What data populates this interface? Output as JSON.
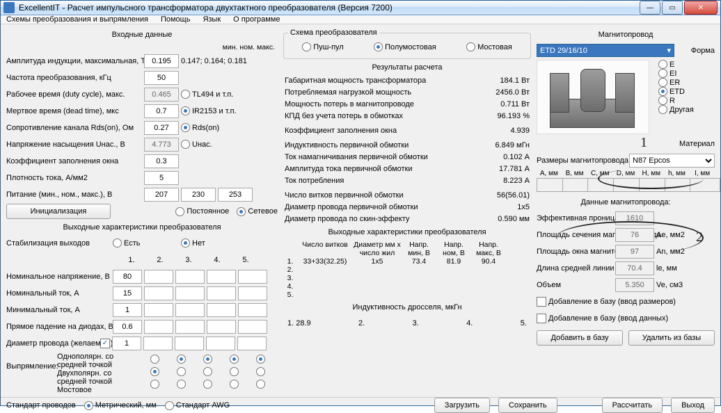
{
  "window_title": "ExcellentIT - Расчет импульсного трансформатора двухтактного преобразователя (Версия 7200)",
  "menu": {
    "m1": "Схемы преобразования и выпрямления",
    "m2": "Помощь",
    "m3": "Язык",
    "m4": "О программе"
  },
  "input": {
    "title": "Входные данные",
    "cols": "мин.  ном.  макс.",
    "r1": {
      "lbl": "Амплитуда индукции, максимальная, Т",
      "v": "0.195",
      "note": "0.147; 0.164; 0.181"
    },
    "r2": {
      "lbl": "Частота преобразования, кГц",
      "v": "50"
    },
    "r3": {
      "lbl": "Рабочее время (duty cycle), макс.",
      "v": "0.465",
      "opt": "TL494 и т.п."
    },
    "r4": {
      "lbl": "Мертвое время (dead time), мкс",
      "v": "0.7",
      "opt": "IR2153 и т.п."
    },
    "r5": {
      "lbl": "Сопротивление канала Rds(on), Ом",
      "v": "0.27",
      "opt": "Rds(on)"
    },
    "r6": {
      "lbl": "Напряжение насыщения Uнас., В",
      "v": "4.773",
      "opt": "Uнас."
    },
    "r7": {
      "lbl": "Коэффициент заполнения окна",
      "v": "0.3"
    },
    "r8": {
      "lbl": "Плотность тока, А/мм2",
      "v": "5"
    },
    "r9": {
      "lbl": "Питание (мин., ном., макс.), В",
      "v1": "207",
      "v2": "230",
      "v3": "253"
    },
    "init": "Инициализация",
    "supply": {
      "o1": "Постоянное",
      "o2": "Сетевое"
    }
  },
  "out": {
    "title": "Выходные характеристики преобразователя",
    "stab": {
      "lbl": "Стабилизация выходов",
      "o1": "Есть",
      "o2": "Нет"
    },
    "hdr": [
      "1.",
      "2.",
      "3.",
      "4.",
      "5."
    ],
    "rA": {
      "lbl": "Номинальное напряжение, В",
      "v": "80"
    },
    "rB": {
      "lbl": "Номинальный ток, А",
      "v": "15"
    },
    "rC": {
      "lbl": "Минимальный ток, А",
      "v": "1"
    },
    "rD": {
      "lbl": "Прямое падение на диодах, В",
      "v": "0.6"
    },
    "rE": {
      "lbl": "Диаметр провода (желаемый), мм",
      "v": "1"
    },
    "rect": {
      "lbl": "Выпрямление:",
      "o1": "Однополярн. со средней точкой",
      "o2": "Двухполярн. со средней точкой",
      "o3": "Мостовое"
    }
  },
  "scheme": {
    "title": "Схема преобразователя",
    "o1": "Пуш-пул",
    "o2": "Полумостовая",
    "o3": "Мостовая"
  },
  "res": {
    "title": "Результаты расчета",
    "r1": {
      "l": "Габаритная мощность трансформатора",
      "v": "184.1 Вт"
    },
    "r2": {
      "l": "Потребляемая нагрузкой мощность",
      "v": "2456.0 Вт"
    },
    "r3": {
      "l": "Мощность потерь в магнитопроводе",
      "v": "0.711 Вт"
    },
    "r4": {
      "l": "КПД без учета потерь в обмотках",
      "v": "96.193 %"
    },
    "r5": {
      "l": "Коэффициент заполнения окна",
      "v": "4.939"
    },
    "r6": {
      "l": "Индуктивность первичной обмотки",
      "v": "6.849 мГн"
    },
    "r7": {
      "l": "Ток намагничивания первичной обмотки",
      "v": "0.102 А"
    },
    "r8": {
      "l": "Амплитуда тока первичной обмотки",
      "v": "17.781 А"
    },
    "r9": {
      "l": "Ток потребления",
      "v": "8.223 А"
    },
    "r10": {
      "l": "Число витков первичной обмотки",
      "v": "56(56.01)"
    },
    "r11": {
      "l": "Диаметр провода первичной обмотки",
      "v": "1x5"
    },
    "r12": {
      "l": "Диаметр провода по скин-эффекту",
      "v": "0.590 мм"
    }
  },
  "outres": {
    "title": "Выходные характеристики преобразователя",
    "h": [
      "Число витков",
      "Диаметр мм x число жил",
      "Напр. мин, В",
      "Напр. ном, В",
      "Напр. макс, В"
    ],
    "row": [
      "1.",
      "33+33(32.25)",
      "1x5",
      "73.4",
      "81.9",
      "90.4"
    ],
    "rows": [
      "2.",
      "3.",
      "4.",
      "5."
    ]
  },
  "ind": {
    "title": "Индуктивность дросселя, мкГн",
    "v": [
      "1. 28.9",
      "2.",
      "3.",
      "4.",
      "5."
    ]
  },
  "core": {
    "title": "Магнитопровод",
    "sel": "ETD 29/16/10",
    "shape": {
      "lbl": "Форма",
      "o": [
        "E",
        "EI",
        "ER",
        "ETD",
        "R",
        "Другая"
      ],
      "sel": 3
    },
    "mat": {
      "lbl": "Материал",
      "sel": "N87 Epcos"
    },
    "dims": {
      "lbl": "Размеры магнитопровода:",
      "h": [
        "A, мм",
        "B, мм",
        "C, мм",
        "D, мм",
        "H, мм",
        "h, мм",
        "I, мм"
      ]
    },
    "data": {
      "title": "Данные магнитопровода:",
      "r1": {
        "l": "Эффективная проницаемость",
        "v": "1610",
        "u": ""
      },
      "r2": {
        "l": "Площадь сечения магнитопровода",
        "v": "76",
        "u": "Ae, мм2"
      },
      "r3": {
        "l": "Площадь окна магнитопровода",
        "v": "97",
        "u": "An, мм2"
      },
      "r4": {
        "l": "Длина средней линии",
        "v": "70.4",
        "u": "le, мм"
      },
      "r5": {
        "l": "Объем",
        "v": "5.350",
        "u": "Ve, см3"
      }
    },
    "add1": "Добавление в базу (ввод размеров)",
    "add2": "Добавление в базу (ввод данных)",
    "btn1": "Добавить в базу",
    "btn2": "Удалить из базы"
  },
  "footer": {
    "std": "Стандарт проводов",
    "o1": "Метрический, мм",
    "o2": "Стандарт AWG",
    "load": "Загрузить",
    "save": "Сохранить",
    "calc": "Рассчитать",
    "exit": "Выход"
  }
}
